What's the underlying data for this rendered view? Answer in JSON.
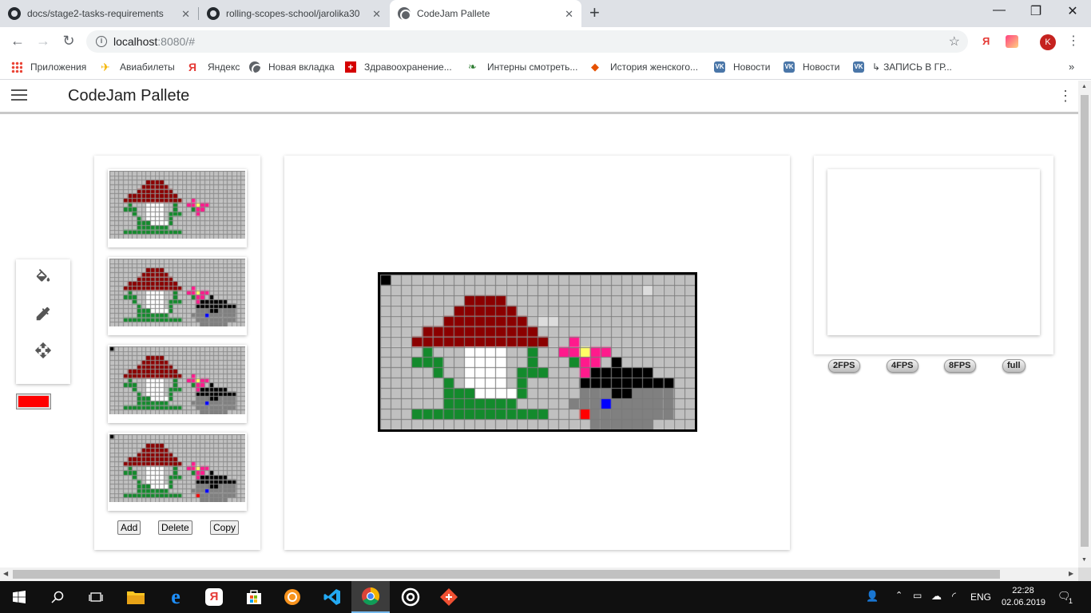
{
  "browser": {
    "tabs": [
      {
        "title": "docs/stage2-tasks-requirements",
        "icon": "github-icon"
      },
      {
        "title": "rolling-scopes-school/jarolika30",
        "icon": "github-icon"
      },
      {
        "title": "CodeJam Pallete",
        "icon": "globe-icon",
        "active": true
      }
    ],
    "url_host": "localhost",
    "url_rest": ":8080/#",
    "avatar_letter": "K",
    "bookmarks": [
      {
        "label": "Приложения",
        "icon": "apps-icon",
        "color": "#4285f4"
      },
      {
        "label": "Авиабилеты",
        "icon": "plane-icon",
        "color": "#f4b400"
      },
      {
        "label": "Яндекс",
        "icon": "yandex-icon",
        "color": "#e53935"
      },
      {
        "label": "Новая вкладка",
        "icon": "globe-icon",
        "color": "#5f6368"
      },
      {
        "label": "Здравоохранение...",
        "icon": "health-cross-icon",
        "color": "#d50000"
      },
      {
        "label": "Интерны смотреть...",
        "icon": "film-icon",
        "color": "#2e7d32"
      },
      {
        "label": "История женского...",
        "icon": "tag-icon",
        "color": "#e65100"
      },
      {
        "label": "Новости",
        "icon": "vk-icon",
        "color": "#4a76a8"
      },
      {
        "label": "Новости",
        "icon": "vk-icon",
        "color": "#4a76a8"
      },
      {
        "label": "ЗАПИСЬ В ГР...",
        "icon": "vk-icon",
        "color": "#4a76a8"
      }
    ]
  },
  "app": {
    "title": "CodeJam Pallete",
    "current_color": "#ff0000",
    "tools": [
      {
        "name": "paint-bucket-icon"
      },
      {
        "name": "color-picker-icon"
      },
      {
        "name": "move-icon"
      }
    ],
    "frame_buttons": {
      "add": "Add",
      "delete": "Delete",
      "copy": "Copy"
    },
    "fps_buttons": [
      "2FPS",
      "4FPS",
      "8FPS",
      "full"
    ],
    "pixel_palette": {
      "0": "#c0c0c0",
      "r": "#8b0000",
      "w": "#ffffff",
      "g": "#138a2c",
      "p": "#ff1a8c",
      "y": "#ffff66",
      "k": "#000000",
      "d": "#808080",
      "b": "#0000ff",
      "R": "#ff0000",
      "L": "#dcdcdc"
    },
    "frames": [
      {
        "layers": [
          "base"
        ]
      },
      {
        "layers": [
          "base",
          "hedgehog"
        ]
      },
      {
        "layers": [
          "base",
          "hedgehog",
          "corner"
        ]
      },
      {
        "layers": [
          "base",
          "hedgehog",
          "corner",
          "red-pixel"
        ]
      }
    ],
    "main_frame_layers": [
      "base",
      "hedgehog",
      "corner",
      "red-pixel",
      "light-cells"
    ],
    "grid": {
      "cols": 30,
      "rows": 15
    },
    "layers": {
      "base": [
        "..............................",
        "..............................",
        "........rrrr..................",
        ".......rrrrrr.................",
        "......rrrrrrrr................",
        "....rrrrrrrrrrr...............",
        "...rrrrrrrrrrrrr..p...........",
        "....g...wwww..g..ppypp........",
        "...ggg..wwww..g...gpp.........",
        ".....g..wwww.ggg...p..........",
        "......g.wwww.g................",
        "......gggwwwwg................",
        "......ggggggg.................",
        "...ggggggggggggg..............",
        ".............................."
      ],
      "hedgehog": [
        "..............................",
        "..............................",
        "..............................",
        "..............................",
        "..............................",
        "..............................",
        "..............................",
        "..............................",
        "......................k.......",
        "....................kkkkkk....",
        "...................kkkkkkkkk..",
        "...................dddkkdddd..",
        "..................dddbdddddd..",
        "...................ddddddddd..",
        "....................dddddd...."
      ],
      "corner": [
        "k.............................",
        "..............................",
        "..............................",
        "..............................",
        "..............................",
        "..............................",
        "..............................",
        "..............................",
        "..............................",
        "..............................",
        "..............................",
        "..............................",
        "..............................",
        "..............................",
        ".............................."
      ],
      "red-pixel": [
        "..............................",
        "..............................",
        "..............................",
        "..............................",
        "..............................",
        "..............................",
        "..............................",
        "..............................",
        "..............................",
        "..............................",
        "..............................",
        "..............................",
        "..............................",
        "...................R..........",
        ".............................."
      ],
      "light-cells": [
        "..............................",
        ".........................L....",
        "..............................",
        "..............................",
        "...............LL.............",
        "..............................",
        "..............................",
        "..............................",
        "..............................",
        "..............................",
        "..............................",
        "..............................",
        "..............................",
        "..............................",
        ".............................."
      ]
    }
  },
  "taskbar": {
    "lang": "ENG",
    "time": "22:28",
    "date": "02.06.2019",
    "notifications": "1",
    "apps": [
      {
        "name": "start-icon"
      },
      {
        "name": "search-icon"
      },
      {
        "name": "task-view-icon"
      },
      {
        "name": "file-explorer-icon"
      },
      {
        "name": "edge-icon"
      },
      {
        "name": "yandex-browser-icon"
      },
      {
        "name": "store-icon"
      },
      {
        "name": "settings-app-icon"
      },
      {
        "name": "vscode-icon"
      },
      {
        "name": "chrome-icon",
        "active": true
      },
      {
        "name": "circle-app-icon"
      },
      {
        "name": "git-icon"
      }
    ]
  }
}
